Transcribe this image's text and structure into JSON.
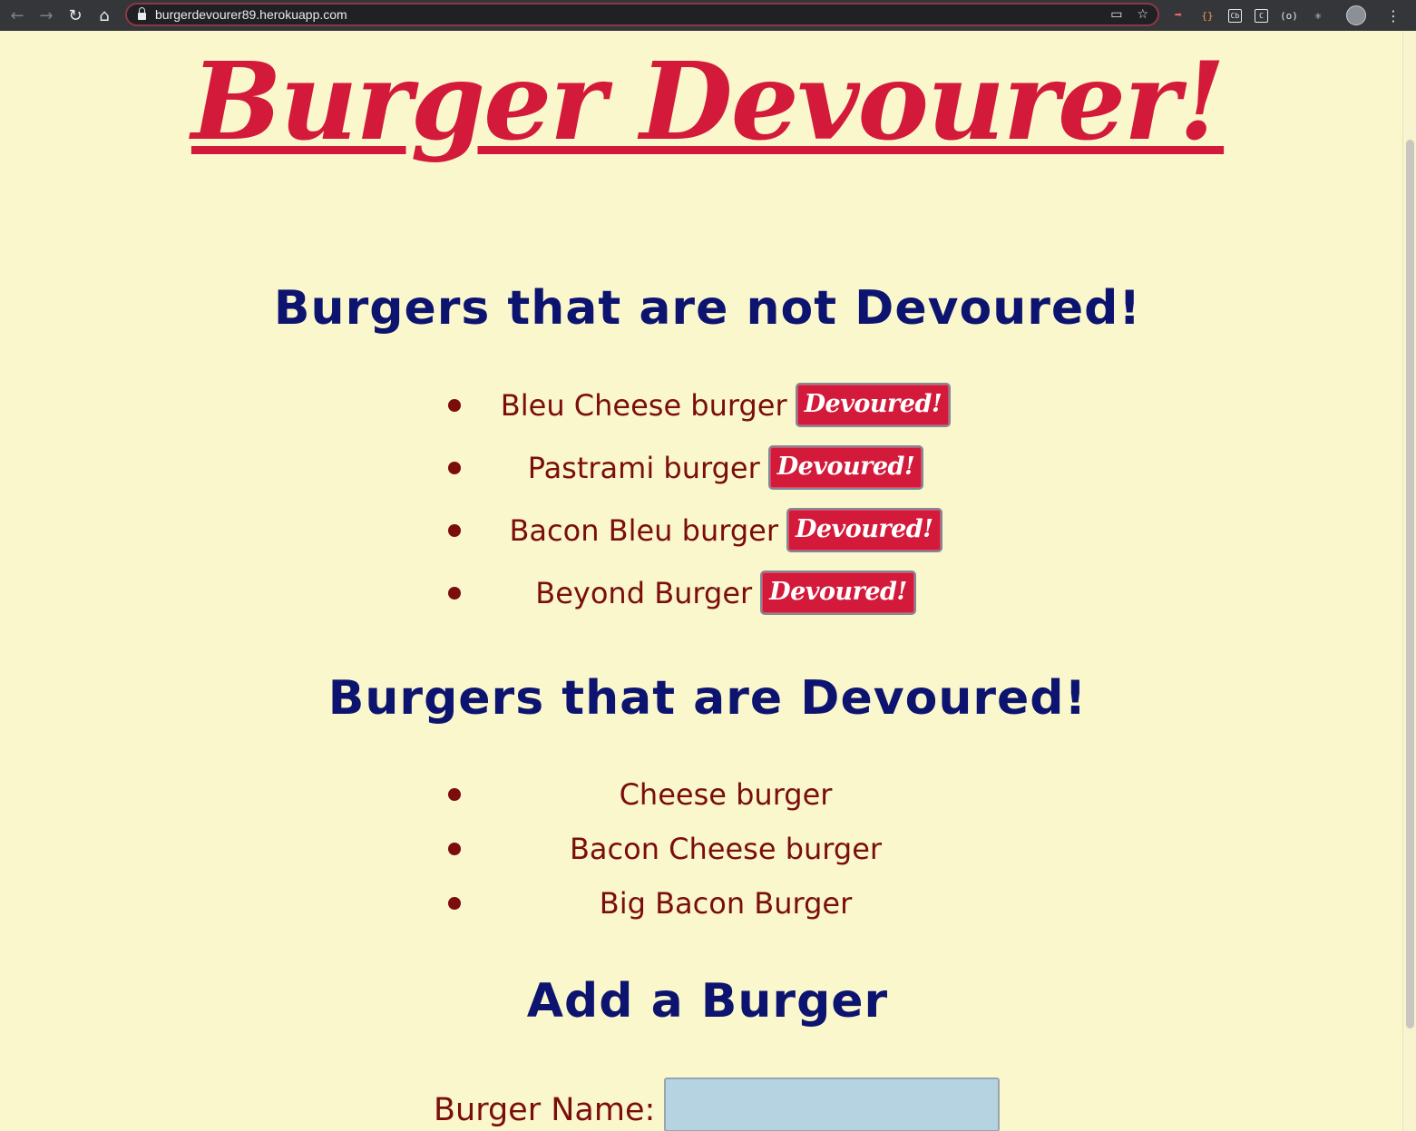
{
  "browser": {
    "url": "burgerdevourer89.herokuapp.com",
    "extensions": [
      {
        "icon": "ext-arrow-icon",
        "glyph": "➡"
      },
      {
        "icon": "ext-braces-icon",
        "glyph": "{}"
      },
      {
        "icon": "ext-cb-icon",
        "glyph": "Cb"
      },
      {
        "icon": "ext-c-icon",
        "glyph": "C"
      },
      {
        "icon": "ext-brackets-icon",
        "glyph": "(o)"
      },
      {
        "icon": "ext-react-icon",
        "glyph": "⚛"
      }
    ]
  },
  "page": {
    "title": "Burger Devourer!",
    "not_devoured_heading": "Burgers that are not Devoured!",
    "devoured_heading": "Burgers that are Devoured!",
    "add_heading": "Add a Burger",
    "devour_button_label": "Devoured!",
    "not_devoured": [
      {
        "name": "Bleu Cheese burger",
        "button": "Devoured!"
      },
      {
        "name": "Pastrami burger",
        "button": "Devoured!"
      },
      {
        "name": "Bacon Bleu burger",
        "button": "Devoured!"
      },
      {
        "name": "Beyond Burger",
        "button": "Devoured!"
      }
    ],
    "devoured": [
      {
        "name": "Cheese burger"
      },
      {
        "name": "Bacon Cheese burger"
      },
      {
        "name": "Big Bacon Burger"
      }
    ],
    "form": {
      "label": "Burger Name:",
      "value": "",
      "placeholder": ""
    }
  },
  "colors": {
    "background": "#faf7cc",
    "title": "#d31a3a",
    "heading": "#0d1470",
    "list_text": "#7b0d0d",
    "button": "#d31a3a",
    "input": "#b5d3e0"
  }
}
